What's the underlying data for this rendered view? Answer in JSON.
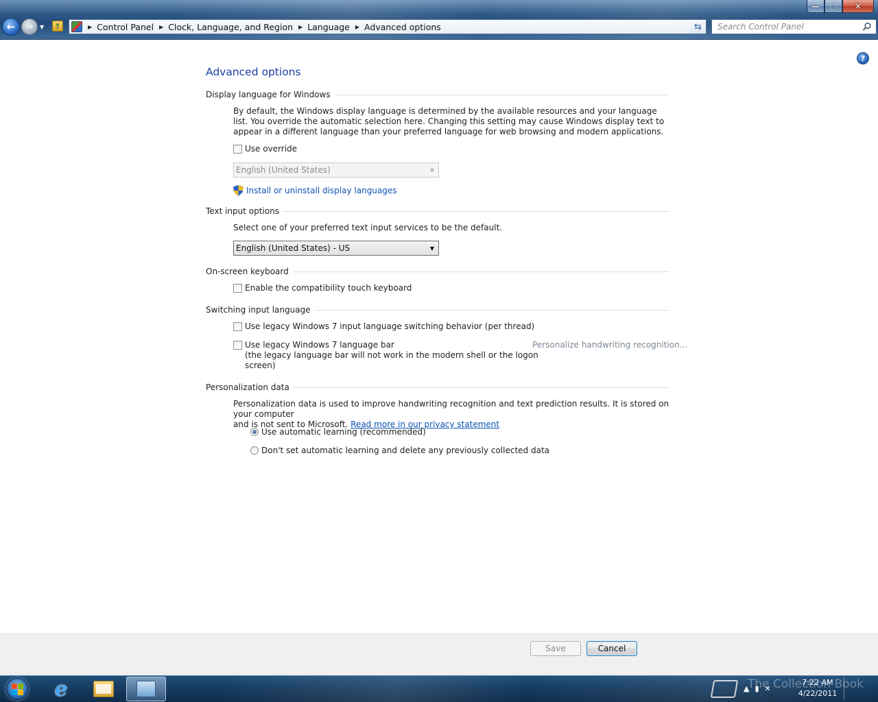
{
  "window": {
    "controls": {
      "minimize": "—",
      "maximize": "□",
      "close": "✕"
    }
  },
  "nav": {
    "back_icon": "back-arrow-icon",
    "forward_icon": "forward-arrow-icon",
    "breadcrumbs": [
      "Control Panel",
      "Clock, Language, and Region",
      "Language",
      "Advanced options"
    ],
    "search_placeholder": "Search Control Panel"
  },
  "page": {
    "title": "Advanced options"
  },
  "display_language": {
    "heading": "Display language for Windows",
    "description": "By default, the Windows display language is determined by the available resources and your language list. You override the automatic selection here. Changing this setting may cause Windows display text to appear in a different language than your preferred language for web browsing and modern applications.",
    "use_override_label": "Use override",
    "use_override_checked": false,
    "language_select_value": "English (United States)",
    "language_select_enabled": false,
    "install_link": "Install or uninstall display languages"
  },
  "text_input": {
    "heading": "Text input options",
    "description": "Select one of your preferred text input services to be the default.",
    "select_value": "English (United States) - US"
  },
  "onscreen_keyboard": {
    "heading": "On-screen keyboard",
    "checkbox_label": "Enable the compatibility touch keyboard",
    "checked": false
  },
  "switching": {
    "heading": "Switching input language",
    "legacy_switching_label": "Use legacy Windows 7 input language switching behavior (per thread)",
    "legacy_bar_label": "Use legacy Windows 7 language bar",
    "legacy_bar_note_line1": "(the legacy language bar will not work in the modern shell or the logon",
    "legacy_bar_note_line2": "screen)",
    "handwriting_link": "Personalize handwriting recognition..."
  },
  "personalization": {
    "heading": "Personalization data",
    "description_line1": "Personalization data is used to improve handwriting recognition and text prediction results. It is stored on your computer",
    "description_line2": "and is not sent to Microsoft.",
    "privacy_link": "Read more in our privacy statement",
    "option_auto": "Use automatic learning (recommended)",
    "option_delete": "Don't set automatic learning and delete any previously collected data",
    "selected": "auto"
  },
  "buttons": {
    "save": "Save",
    "cancel": "Cancel",
    "save_enabled": false
  },
  "taskbar": {
    "time": "7:22 AM",
    "date": "4/22/2011",
    "watermark": "The Collection Book",
    "ie_glyph": "e"
  },
  "colors": {
    "accent_link": "#0b52b3",
    "title_blue": "#1c3fa4",
    "taskbar": "#183e63"
  }
}
